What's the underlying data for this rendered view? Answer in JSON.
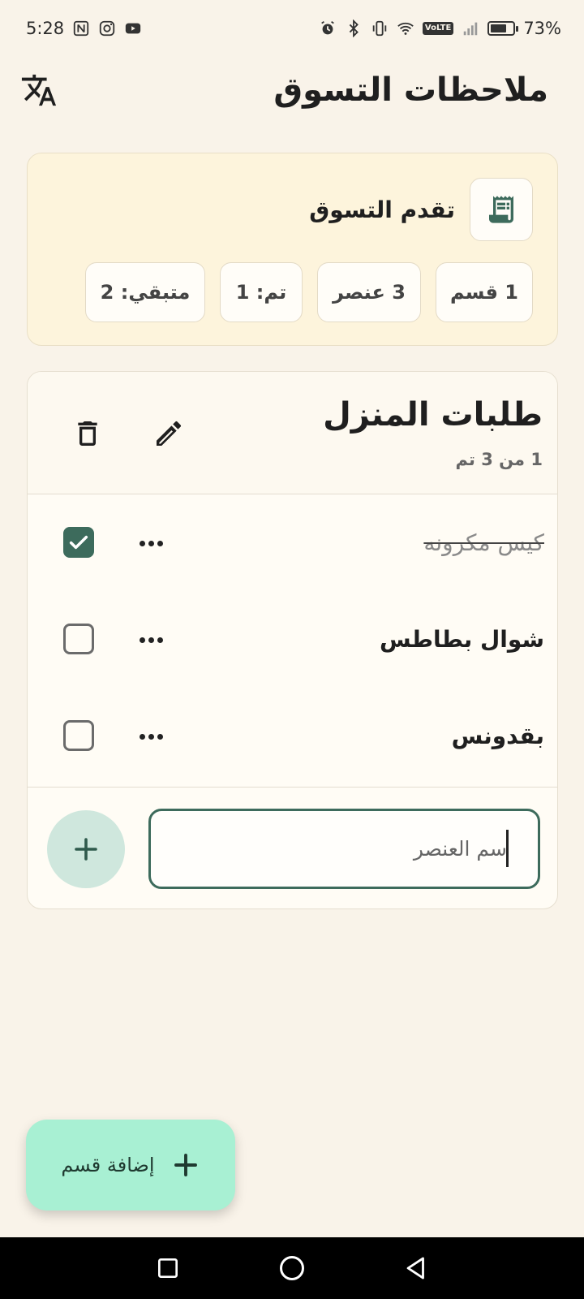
{
  "status_bar": {
    "time": "5:28",
    "left_icons": [
      "nfc-icon",
      "instagram-icon",
      "youtube-icon"
    ],
    "right_icons": [
      "alarm-icon",
      "bluetooth-icon",
      "vibrate-icon",
      "wifi-icon",
      "volte-icon",
      "signal-icon",
      "battery-icon"
    ],
    "volte": "VoLTE",
    "battery": "73%",
    "battery_level": 0.73
  },
  "app_bar": {
    "title": "ملاحظات التسوق",
    "translate_icon": "translate-icon"
  },
  "progress": {
    "title": "تقدم التسوق",
    "icon": "receipt-icon",
    "stats": {
      "sections": "1 قسم",
      "items": "3 عنصر",
      "done": "تم: 1",
      "remaining": "متبقي: 2"
    }
  },
  "section": {
    "title": "طلبات المنزل",
    "subtitle": "1 من 3 تم",
    "items": [
      {
        "name": "كيس مكرونه",
        "checked": true
      },
      {
        "name": "شوال بطاطس",
        "checked": false
      },
      {
        "name": "بقدونس",
        "checked": false
      }
    ],
    "input_placeholder": "سم العنصر"
  },
  "fab": {
    "label": "إضافة قسم",
    "icon": "plus-icon"
  },
  "colors": {
    "background": "#f9f3e9",
    "accent": "#3d6b5c",
    "fab": "#a8f0d3",
    "progress_card": "#fdf4dc"
  }
}
